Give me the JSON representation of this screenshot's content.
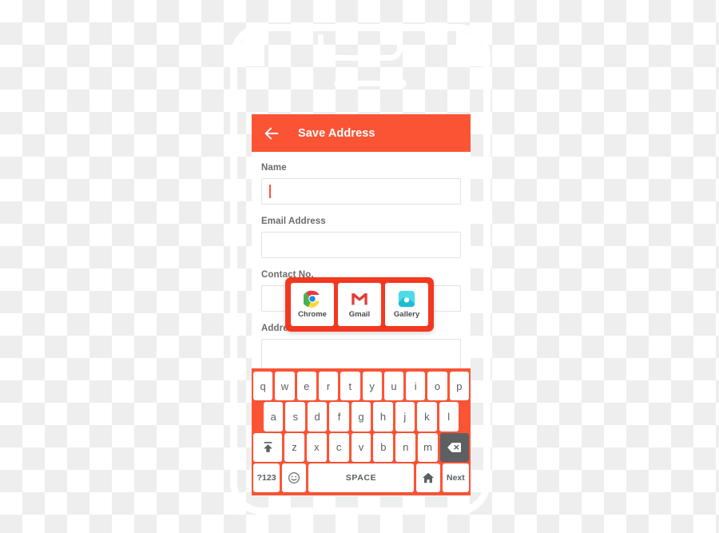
{
  "theme": {
    "accent": "#fb5435",
    "popup_red": "#f4381f",
    "key_bg": "#ffffff",
    "key_text": "#5a5f63",
    "key_dark": "#5c6063",
    "label_text": "#6b6b6b",
    "field_border": "#e2e2e2"
  },
  "appbar": {
    "back_icon": "back-arrow-icon",
    "title": "Save Address"
  },
  "form": {
    "fields": [
      {
        "label": "Name",
        "value": "",
        "focused": true,
        "multiline": false
      },
      {
        "label": "Email Address",
        "value": "",
        "focused": false,
        "multiline": false
      },
      {
        "label": "Contact No.",
        "value": "",
        "focused": false,
        "multiline": false
      },
      {
        "label": "Address",
        "value": "",
        "focused": false,
        "multiline": true
      }
    ]
  },
  "app_chooser": {
    "apps": [
      {
        "label": "Chrome",
        "icon": "chrome-icon"
      },
      {
        "label": "Gmail",
        "icon": "gmail-icon"
      },
      {
        "label": "Gallery",
        "icon": "gallery-icon"
      }
    ]
  },
  "keyboard": {
    "row1": [
      "q",
      "w",
      "e",
      "r",
      "t",
      "y",
      "u",
      "i",
      "o",
      "p"
    ],
    "row2": [
      "a",
      "s",
      "d",
      "f",
      "g",
      "h",
      "j",
      "k",
      "l"
    ],
    "row3_letters": [
      "z",
      "x",
      "c",
      "v",
      "b",
      "n",
      "m"
    ],
    "shift_key": "shift-icon",
    "backspace_key": "backspace-icon",
    "numbers_key": "?123",
    "emoji_key": "emoji-icon",
    "space_key": "SPACE",
    "home_key": "home-icon",
    "next_key": "Next"
  }
}
